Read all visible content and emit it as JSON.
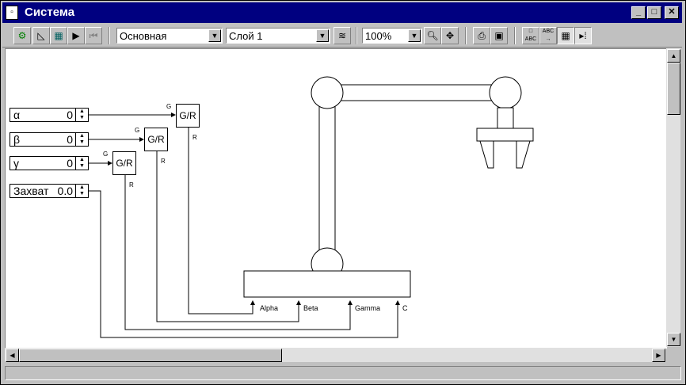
{
  "window": {
    "title": "Система",
    "app_icon": "diagram-window-icon",
    "controls": [
      "minimize",
      "maximize",
      "close"
    ]
  },
  "toolbar": {
    "buttons_left": [
      "model-icon",
      "triangle-ruler-icon",
      "calculator-icon",
      "play-icon",
      "step-back-icon"
    ],
    "view_combo": "Основная",
    "layer_combo": "Слой 1",
    "zoom_combo": "100%",
    "buttons_right": [
      "layers-icon",
      "zoom-icon",
      "move-icon",
      "print-icon",
      "fit-icon",
      "abc-icon",
      "abc-arrow-icon",
      "grid-icon",
      "grid-arrow-icon"
    ]
  },
  "inputs": [
    {
      "label": "α",
      "value": "0"
    },
    {
      "label": "β",
      "value": "0"
    },
    {
      "label": "γ",
      "value": "0"
    },
    {
      "label": "Захват",
      "value": "0.0"
    }
  ],
  "blocks": [
    {
      "text": "G/R",
      "in_port": "G",
      "out_port": "R"
    },
    {
      "text": "G/R",
      "in_port": "G",
      "out_port": "R"
    },
    {
      "text": "G/R",
      "in_port": "G",
      "out_port": "R"
    }
  ],
  "robot": {
    "ports": [
      "Alpha",
      "Beta",
      "Gamma",
      "C"
    ]
  }
}
